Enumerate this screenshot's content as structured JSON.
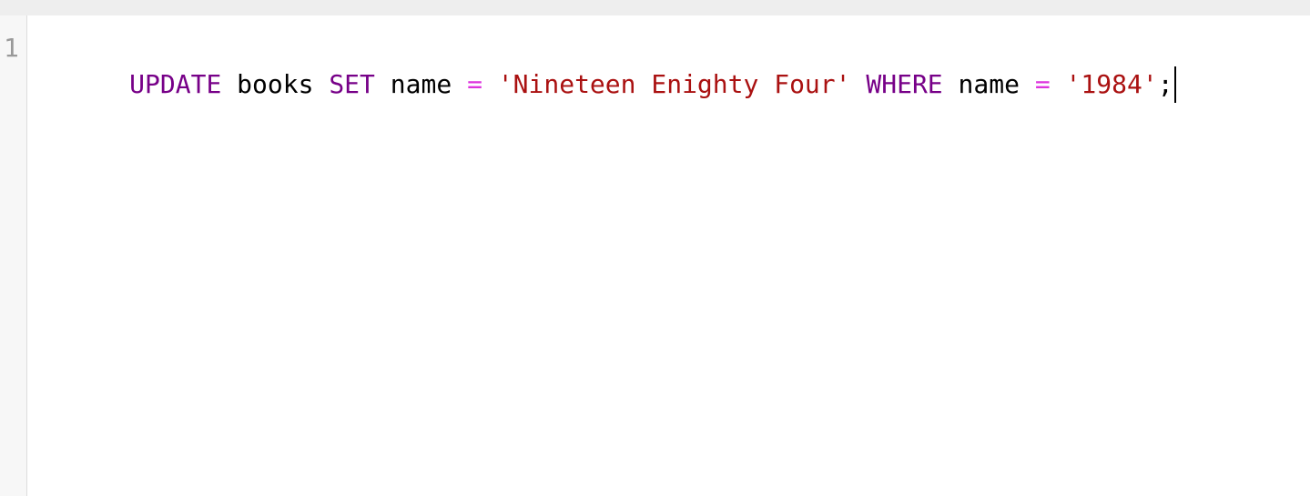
{
  "window": {
    "top_bar_color": "#eeeeee"
  },
  "editor": {
    "gutter": {
      "line_numbers": [
        "1"
      ]
    },
    "lines": [
      {
        "tokens": [
          {
            "text": "UPDATE",
            "type": "keyword"
          },
          {
            "text": " ",
            "type": "space"
          },
          {
            "text": "books",
            "type": "ident"
          },
          {
            "text": " ",
            "type": "space"
          },
          {
            "text": "SET",
            "type": "keyword"
          },
          {
            "text": " ",
            "type": "space"
          },
          {
            "text": "name",
            "type": "ident"
          },
          {
            "text": " ",
            "type": "space"
          },
          {
            "text": "=",
            "type": "operator"
          },
          {
            "text": " ",
            "type": "space"
          },
          {
            "text": "'Nineteen Enighty Four'",
            "type": "string"
          },
          {
            "text": " ",
            "type": "space"
          },
          {
            "text": "WHERE",
            "type": "keyword"
          },
          {
            "text": " ",
            "type": "space"
          },
          {
            "text": "name",
            "type": "ident"
          },
          {
            "text": " ",
            "type": "space"
          },
          {
            "text": "=",
            "type": "operator"
          },
          {
            "text": " ",
            "type": "space"
          },
          {
            "text": "'1984'",
            "type": "string"
          },
          {
            "text": ";",
            "type": "punct"
          }
        ]
      }
    ],
    "colors": {
      "keyword": "#770088",
      "operator": "#dd33dd",
      "string": "#aa1111",
      "line_number": "#999999"
    }
  }
}
